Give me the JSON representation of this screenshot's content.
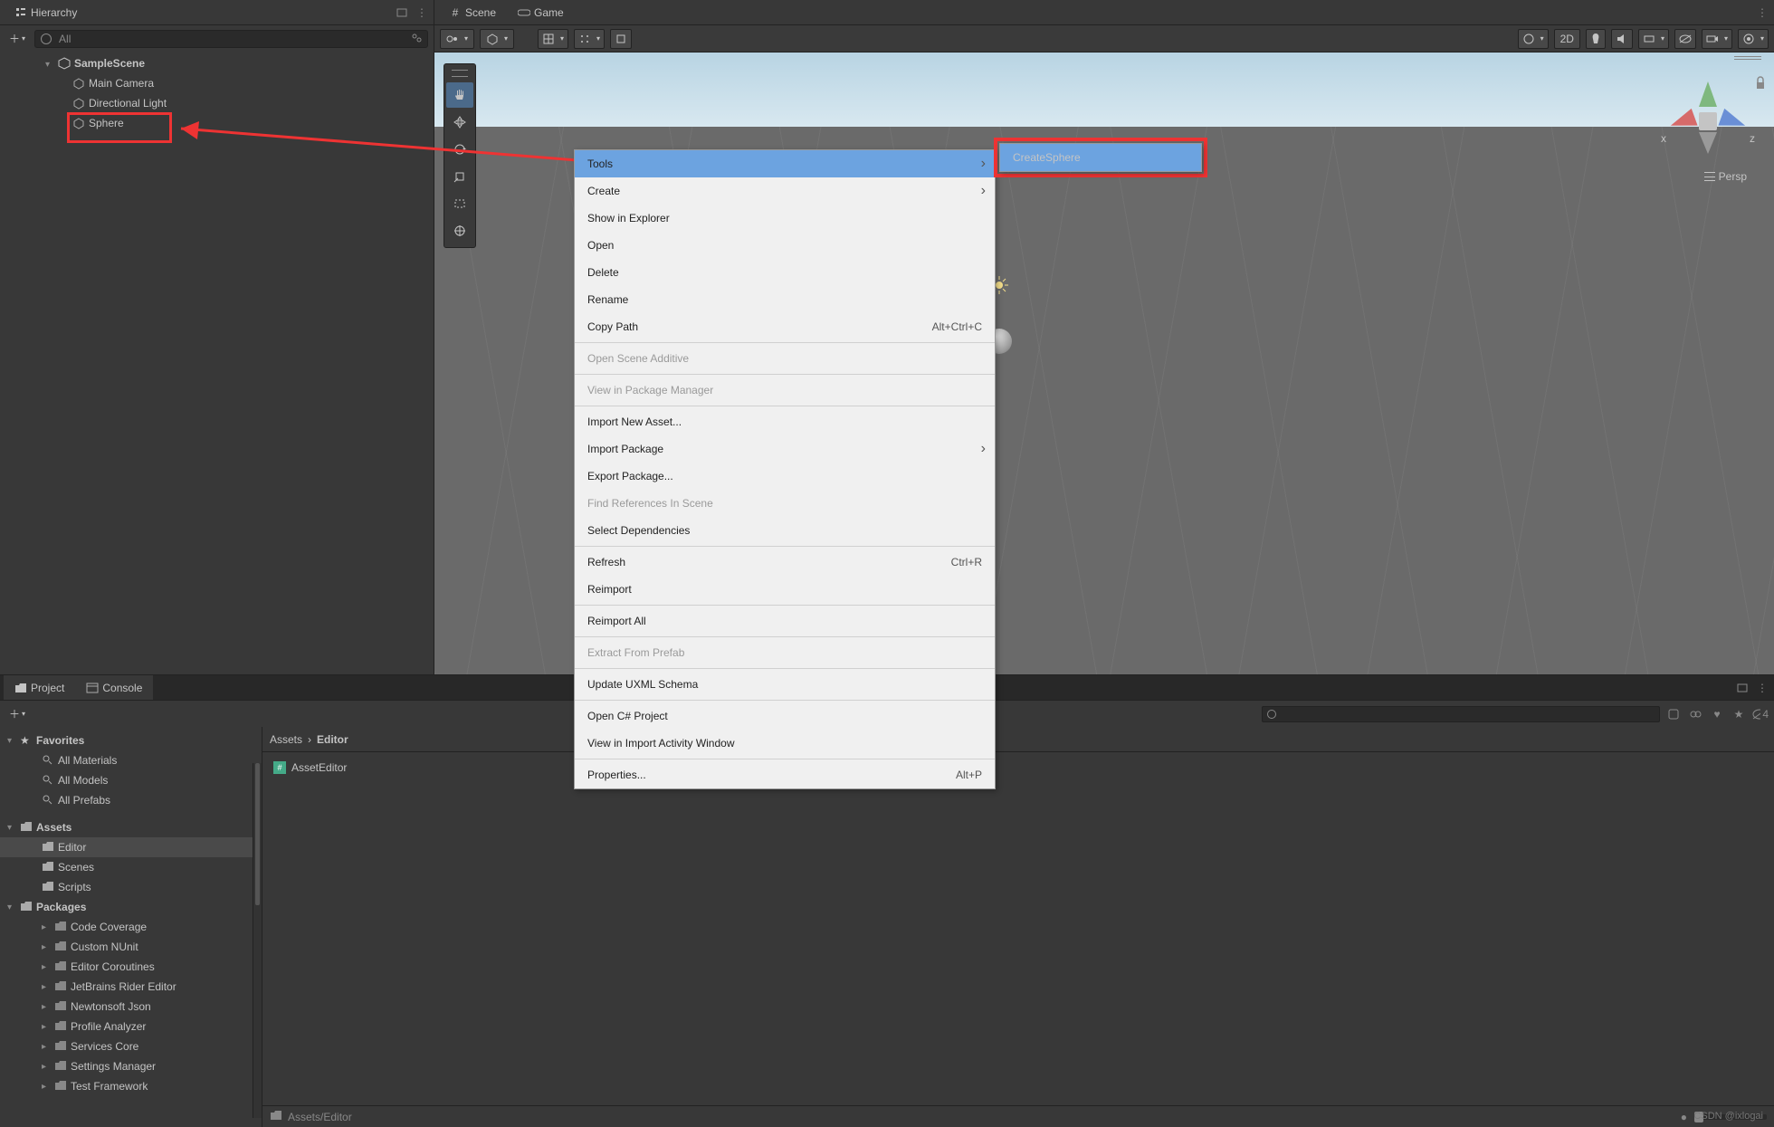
{
  "hierarchy": {
    "tab": "Hierarchy",
    "search_placeholder": "All",
    "scene_name": "SampleScene",
    "items": [
      {
        "name": "Main Camera"
      },
      {
        "name": "Directional Light"
      },
      {
        "name": "Sphere"
      }
    ]
  },
  "scene": {
    "tab_scene": "Scene",
    "tab_game": "Game",
    "toolbar": {
      "mode_2d": "2D"
    },
    "persp_label": "Persp",
    "gizmo_axes": {
      "x": "x",
      "z": "z"
    }
  },
  "context_menu": {
    "items": [
      {
        "label": "Tools",
        "submenu": true,
        "highlight": true
      },
      {
        "label": "Create",
        "submenu": true
      },
      {
        "label": "Show in Explorer"
      },
      {
        "label": "Open"
      },
      {
        "label": "Delete"
      },
      {
        "label": "Rename"
      },
      {
        "label": "Copy Path",
        "shortcut": "Alt+Ctrl+C"
      },
      {
        "sep": true
      },
      {
        "label": "Open Scene Additive",
        "disabled": true
      },
      {
        "sep": true
      },
      {
        "label": "View in Package Manager",
        "disabled": true
      },
      {
        "sep": true
      },
      {
        "label": "Import New Asset..."
      },
      {
        "label": "Import Package",
        "submenu": true
      },
      {
        "label": "Export Package..."
      },
      {
        "label": "Find References In Scene",
        "disabled": true
      },
      {
        "label": "Select Dependencies"
      },
      {
        "sep": true
      },
      {
        "label": "Refresh",
        "shortcut": "Ctrl+R"
      },
      {
        "label": "Reimport"
      },
      {
        "sep": true
      },
      {
        "label": "Reimport All"
      },
      {
        "sep": true
      },
      {
        "label": "Extract From Prefab",
        "disabled": true
      },
      {
        "sep": true
      },
      {
        "label": "Update UXML Schema"
      },
      {
        "sep": true
      },
      {
        "label": "Open C# Project"
      },
      {
        "label": "View in Import Activity Window"
      },
      {
        "sep": true
      },
      {
        "label": "Properties...",
        "shortcut": "Alt+P"
      }
    ],
    "submenu_label": "CreateSphere"
  },
  "project": {
    "tab_project": "Project",
    "tab_console": "Console",
    "favorites_label": "Favorites",
    "favorites": [
      "All Materials",
      "All Models",
      "All Prefabs"
    ],
    "assets_label": "Assets",
    "assets_children": [
      "Editor",
      "Scenes",
      "Scripts"
    ],
    "packages_label": "Packages",
    "packages": [
      "Code Coverage",
      "Custom NUnit",
      "Editor Coroutines",
      "JetBrains Rider Editor",
      "Newtonsoft Json",
      "Profile Analyzer",
      "Services Core",
      "Settings Manager",
      "Test Framework"
    ]
  },
  "assets_panel": {
    "breadcrumb": [
      "Assets",
      "Editor"
    ],
    "items": [
      {
        "name": "AssetEditor"
      }
    ],
    "footer_path": "Assets/Editor",
    "hidden_count": "4"
  },
  "watermark": "CSDN @ixlogai"
}
